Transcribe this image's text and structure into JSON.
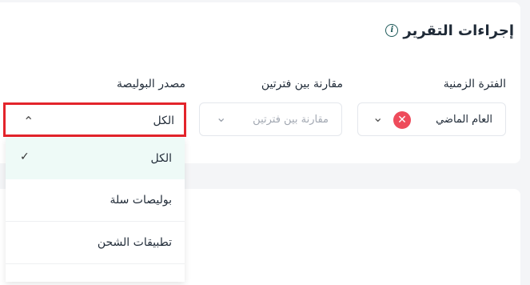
{
  "report": {
    "title": "إجراءات التقرير",
    "info_glyph": "i"
  },
  "filters": {
    "period": {
      "label": "الفترة الزمنية",
      "value": "العام الماضي",
      "clear_glyph": "✕",
      "chevron_glyph": "⌄"
    },
    "compare": {
      "label": "مقارنة بين فترتين",
      "placeholder": "مقارنة بين فترتين",
      "chevron_glyph": "⌄"
    },
    "source": {
      "label": "مصدر البوليصة",
      "value": "الكل",
      "chevron_glyph": "⌃",
      "highlight_color": "#e3242b",
      "options": [
        {
          "label": "الكل",
          "selected": true,
          "check_glyph": "✓"
        },
        {
          "label": "بوليصات سلة",
          "selected": false
        },
        {
          "label": "تطبيقات الشحن",
          "selected": false
        }
      ]
    }
  }
}
